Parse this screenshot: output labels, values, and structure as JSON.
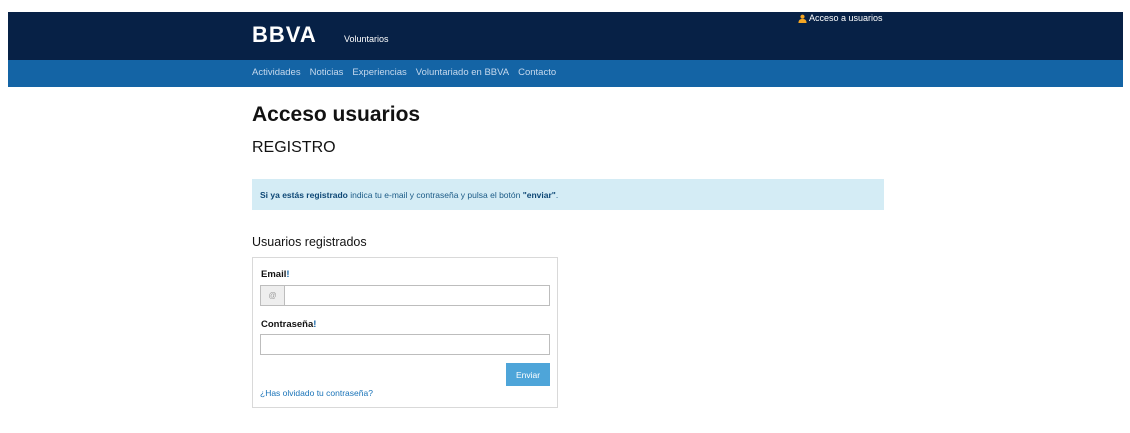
{
  "header": {
    "logo_text": "BBVA",
    "site_name": "Voluntarios",
    "user_access_label": "Acceso a usuarios",
    "user_icon": "user-icon",
    "colors": {
      "top_bar": "#072146",
      "nav_bar": "#1464a5"
    }
  },
  "nav": {
    "items": [
      {
        "label": "Actividades"
      },
      {
        "label": "Noticias"
      },
      {
        "label": "Experiencias"
      },
      {
        "label": "Voluntariado en BBVA"
      },
      {
        "label": "Contacto"
      }
    ]
  },
  "main": {
    "page_title": "Acceso usuarios",
    "section_title": "REGISTRO",
    "info": {
      "bold_lead": "Si ya estás registrado",
      "text": " indica tu e-mail y contraseña y pulsa el botón ",
      "bold_action": "\"enviar\"",
      "end": ".",
      "background": "#d4ecf5"
    },
    "group_title": "Usuarios registrados",
    "form": {
      "email_label": "Email",
      "password_label": "Contraseña",
      "required_mark": "!",
      "email_addon": "@",
      "email_placeholder": "",
      "password_placeholder": "",
      "submit_label": "Enviar",
      "forgot_label": "¿Has olvidado tu contraseña?"
    }
  }
}
